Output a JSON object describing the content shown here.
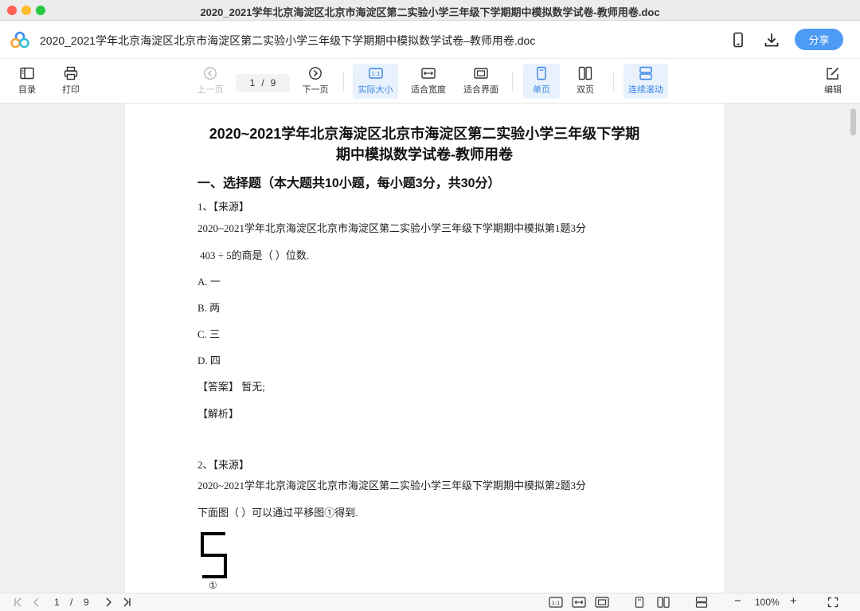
{
  "window": {
    "title": "2020_2021学年北京海淀区北京市海淀区第二实验小学三年级下学期期中模拟数学试卷-教师用卷.doc"
  },
  "header": {
    "doc_name": "2020_2021学年北京海淀区北京市海淀区第二实验小学三年级下学期期中模拟数学试卷–教师用卷.doc",
    "share_label": "分享",
    "accent_color": "#4e9bf5"
  },
  "toolbar": {
    "toc_label": "目录",
    "print_label": "打印",
    "prev_label": "上一页",
    "current_page": "1",
    "page_sep": "/",
    "total_pages": "9",
    "next_label": "下一页",
    "actual_size_label": "实际大小",
    "actual_size_glyph": "1:1",
    "fit_width_label": "适合宽度",
    "fit_window_label": "适合界面",
    "single_label": "单页",
    "double_label": "双页",
    "continuous_label": "连续滚动",
    "edit_label": "编辑"
  },
  "document": {
    "title_line1": "2020~2021学年北京海淀区北京市海淀区第二实验小学三年级下学期",
    "title_line2": "期中模拟数学试卷-教师用卷",
    "section1": "一、选择题（本大题共10小题，每小题3分，共30分）",
    "q1": {
      "header": "1、【来源】",
      "source": "2020~2021学年北京海淀区北京市海淀区第二实验小学三年级下学期期中模拟第1题3分",
      "stem": "403 ÷ 5的商是（   ）位数.",
      "options": [
        "A. 一",
        "B. 两",
        "C. 三",
        "D. 四"
      ],
      "answer": "【答案】 暂无;",
      "analysis": "【解析】"
    },
    "q2": {
      "header": "2、【来源】",
      "source": "2020~2021学年北京海淀区北京市海淀区第二实验小学三年级下学期期中模拟第2题3分",
      "stem": "下面图（   ）可以通过平移图①得到.",
      "figure_label": "①"
    }
  },
  "statusbar": {
    "current_page": "1",
    "page_sep": "/",
    "total_pages": "9",
    "ratio_glyph": "1:1",
    "zoom": "100%",
    "zoom_out": "−",
    "zoom_in": "+"
  }
}
